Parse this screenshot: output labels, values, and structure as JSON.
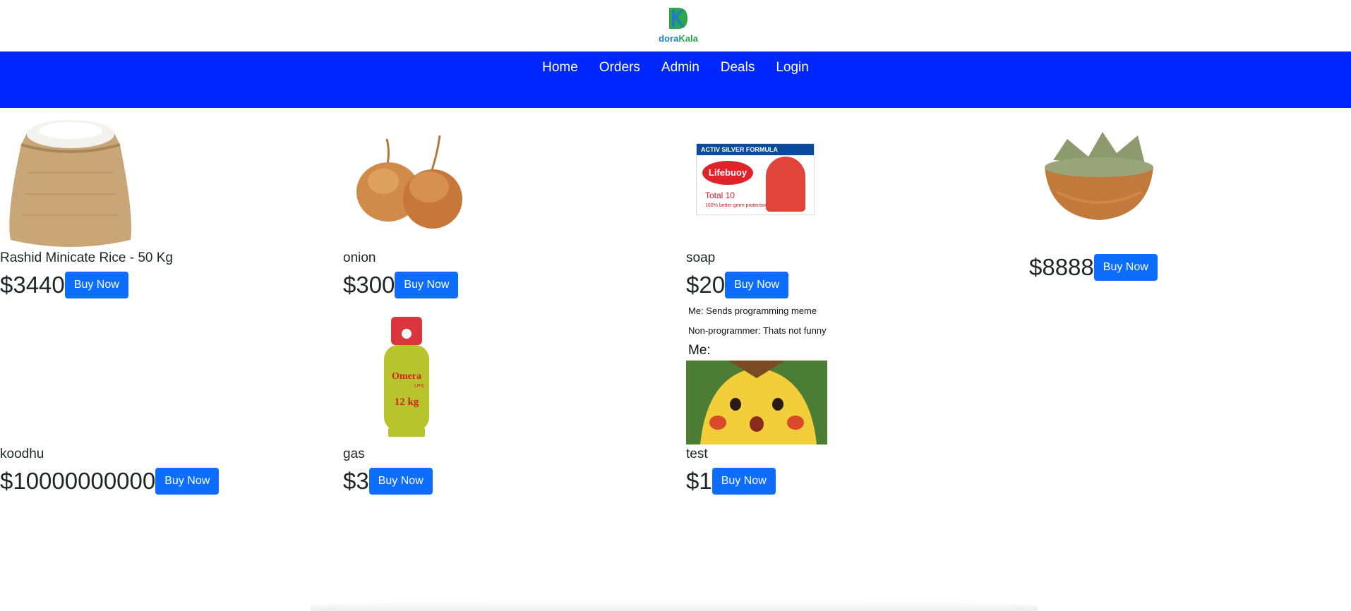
{
  "brand": {
    "logo_text_1": "dora",
    "logo_text_2": "Kala"
  },
  "nav": {
    "items": [
      "Home",
      "Orders",
      "Admin",
      "Deals",
      "Login"
    ]
  },
  "products": [
    {
      "name": "Rashid Minicate Rice - 50 Kg",
      "price": "$3440",
      "button": "Buy Now",
      "image": "rice-sack-image"
    },
    {
      "name": "onion",
      "price": "$300",
      "button": "Buy Now",
      "image": "onion-image"
    },
    {
      "name": "soap",
      "price": "$20",
      "button": "Buy Now",
      "image": "soap-image"
    },
    {
      "name": "",
      "price": "$8888",
      "button": "Buy Now",
      "image": "bay-leaf-bowl-image"
    },
    {
      "name": "koodhu",
      "price": "$10000000000",
      "button": "Buy Now",
      "image": ""
    },
    {
      "name": "gas",
      "price": "$3",
      "button": "Buy Now",
      "image": "gas-cylinder-image"
    },
    {
      "name": "test",
      "price": "$1",
      "button": "Buy Now",
      "image": "meme-image"
    }
  ],
  "soap_box": {
    "top": "ACTIV SILVER FORMULA",
    "brand": "Lifebuoy",
    "sub": "Total 10",
    "tag": "100% better germ protection"
  },
  "gas_label": {
    "brand": "Omera",
    "lpg": "LPG",
    "weight": "12 kg"
  },
  "meme": {
    "line1": "Me: Sends programming meme",
    "line2": "Non-programmer: Thats not funny",
    "line3": "Me:"
  },
  "colors": {
    "navbar": "#0027ff",
    "button": "#0d6efd"
  }
}
